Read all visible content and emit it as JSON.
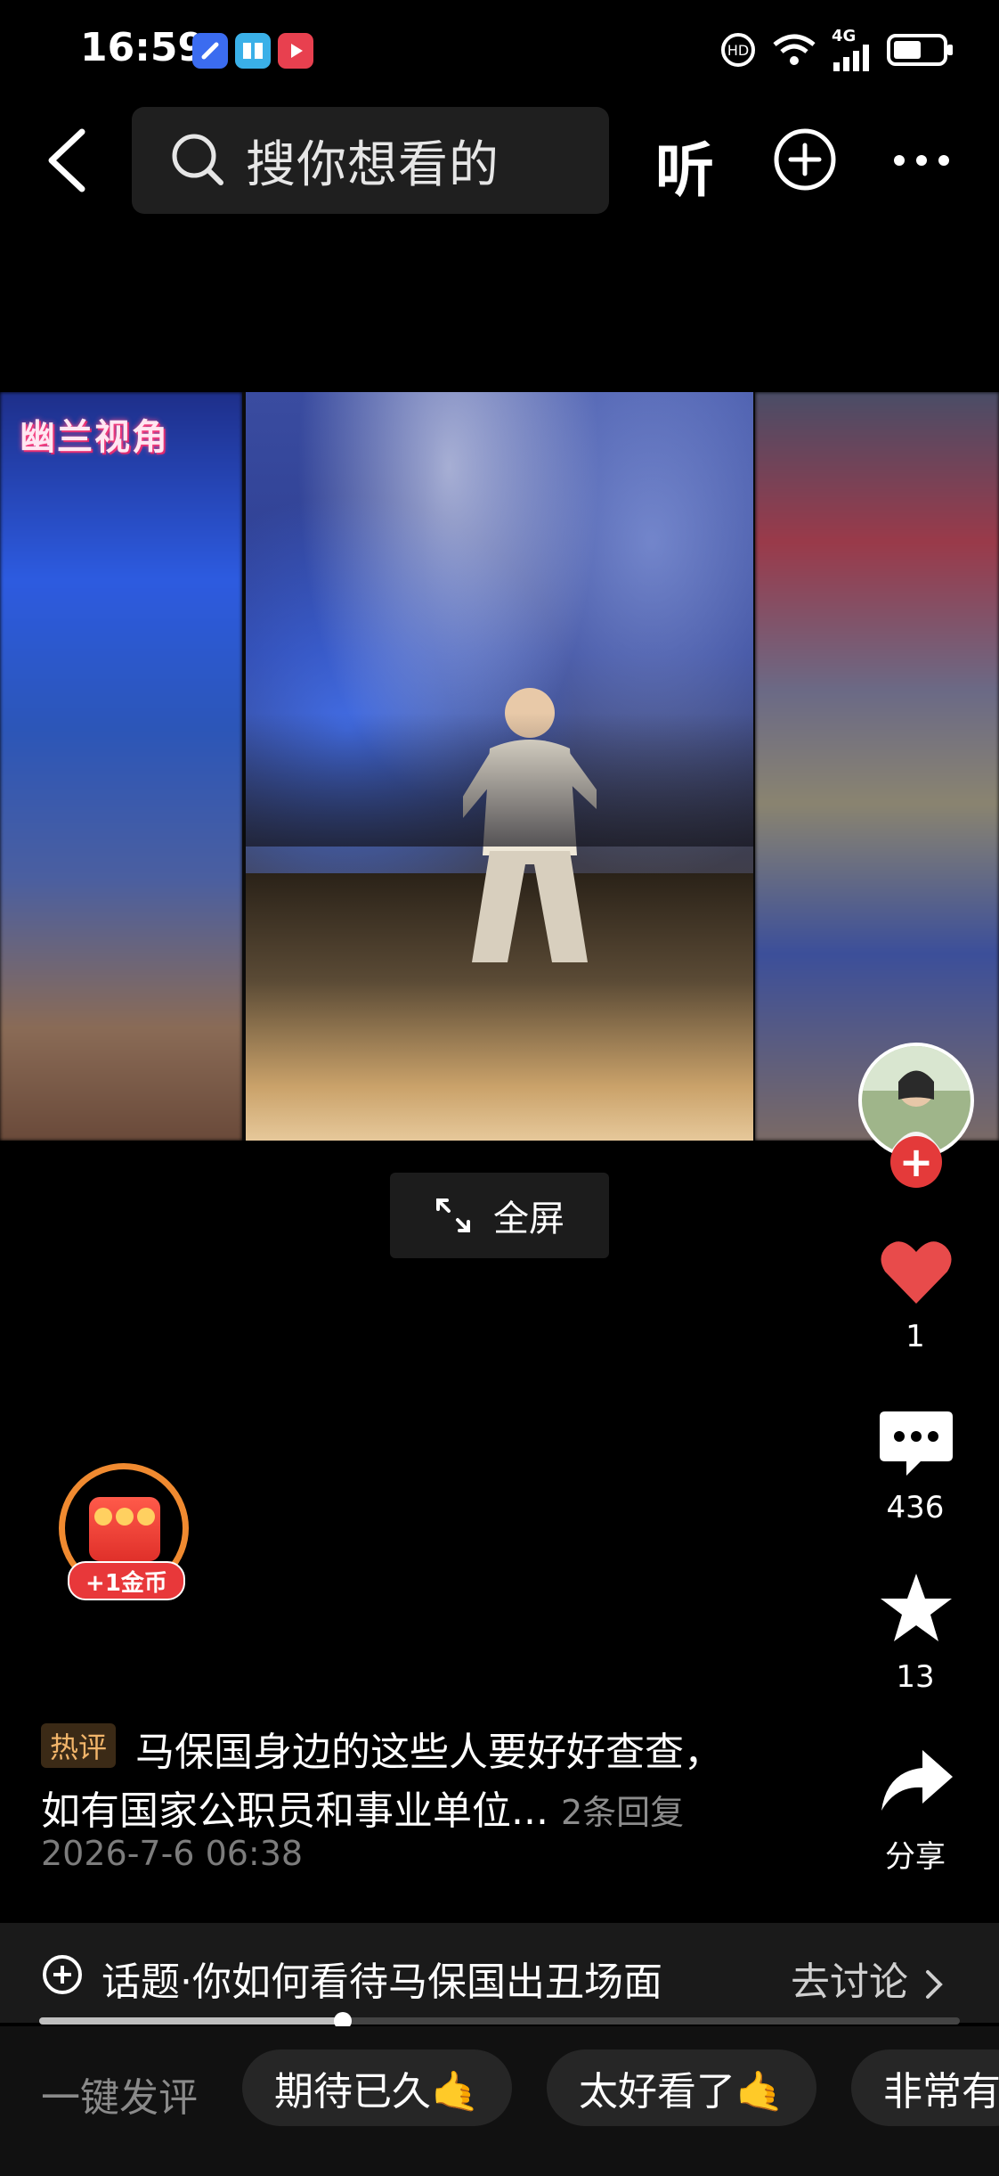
{
  "status_bar": {
    "time": "16:59",
    "network": "4G"
  },
  "top_bar": {
    "search_placeholder": "搜你想看的",
    "listen_label": "听"
  },
  "video": {
    "watermark": "幽兰视角"
  },
  "fullscreen_label": "全屏",
  "side_actions": {
    "like_count": "1",
    "comment_count": "436",
    "favorite_count": "13",
    "share_label": "分享"
  },
  "coin_badge": {
    "label": "+1金币"
  },
  "hot_comment": {
    "tag": "热评",
    "line1": "马保国身边的这些人要好好查查，",
    "line2": "如有国家公职员和事业单位...",
    "replies": "2条回复",
    "time": "2026-7-6 06:38"
  },
  "topic": {
    "text": "话题·你如何看待马保国出丑场面",
    "action": "去讨论"
  },
  "playback": {
    "progress": 0.33
  },
  "quick_comment": {
    "label": "一键发评",
    "chips": [
      "期待已久🤙",
      "太好看了🤙",
      "非常有"
    ]
  },
  "colors": {
    "background": "#000000",
    "like_red": "#e84b4b",
    "follow_red": "#e43a3a",
    "coin_orange": "#f08a30"
  }
}
